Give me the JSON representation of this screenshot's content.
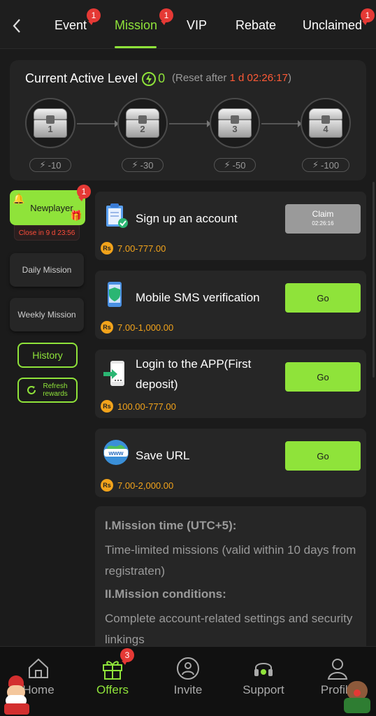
{
  "tabs": [
    {
      "label": "Event",
      "badge": "1"
    },
    {
      "label": "Mission",
      "badge": "1",
      "active": true
    },
    {
      "label": "VIP",
      "badge": ""
    },
    {
      "label": "Rebate",
      "badge": ""
    },
    {
      "label": "Unclaimed",
      "badge": "1"
    }
  ],
  "level": {
    "title": "Current Active Level",
    "value": "0",
    "reset_prefix": "(Reset after ",
    "reset_time": "1 d 02:26:17",
    "reset_suffix": ")",
    "chests": [
      {
        "num": "1",
        "points": "-10"
      },
      {
        "num": "2",
        "points": "-30"
      },
      {
        "num": "3",
        "points": "-50"
      },
      {
        "num": "4",
        "points": "-100"
      }
    ]
  },
  "side": {
    "newplayer": "Newplayer",
    "newplayer_badge": "1",
    "close_timer": "Close in 9 d 23:56",
    "daily": "Daily Mission",
    "weekly": "Weekly Mission",
    "history": "History",
    "refresh": "Refresh rewards"
  },
  "missions": [
    {
      "title": "Sign up an account",
      "reward": "7.00-777.00",
      "button": "Claim",
      "button_time": "02:26:16",
      "state": "claim"
    },
    {
      "title": "Mobile SMS verification",
      "reward": "7.00-1,000.00",
      "button": "Go",
      "state": "go"
    },
    {
      "title": "Login to the APP(First deposit)",
      "reward": "100.00-777.00",
      "button": "Go",
      "state": "go"
    },
    {
      "title": "Save URL",
      "reward": "7.00-2,000.00",
      "button": "Go",
      "state": "go"
    }
  ],
  "currency_symbol": "Rs",
  "rules": {
    "h1": "I.Mission time (UTC+5):",
    "p1": "Time-limited missions (valid within 10 days from registraten)",
    "h2": "II.Mission conditions:",
    "p2": "Complete account-related settings and security linkings"
  },
  "bottom_nav": {
    "home": "Home",
    "offers": "Offers",
    "offers_badge": "3",
    "invite": "Invite",
    "support": "Support",
    "profile": "Profile"
  },
  "colors": {
    "accent": "#8fe33a",
    "badge": "#e53935",
    "reward": "#f2a31b",
    "timer": "#ff5a36"
  }
}
